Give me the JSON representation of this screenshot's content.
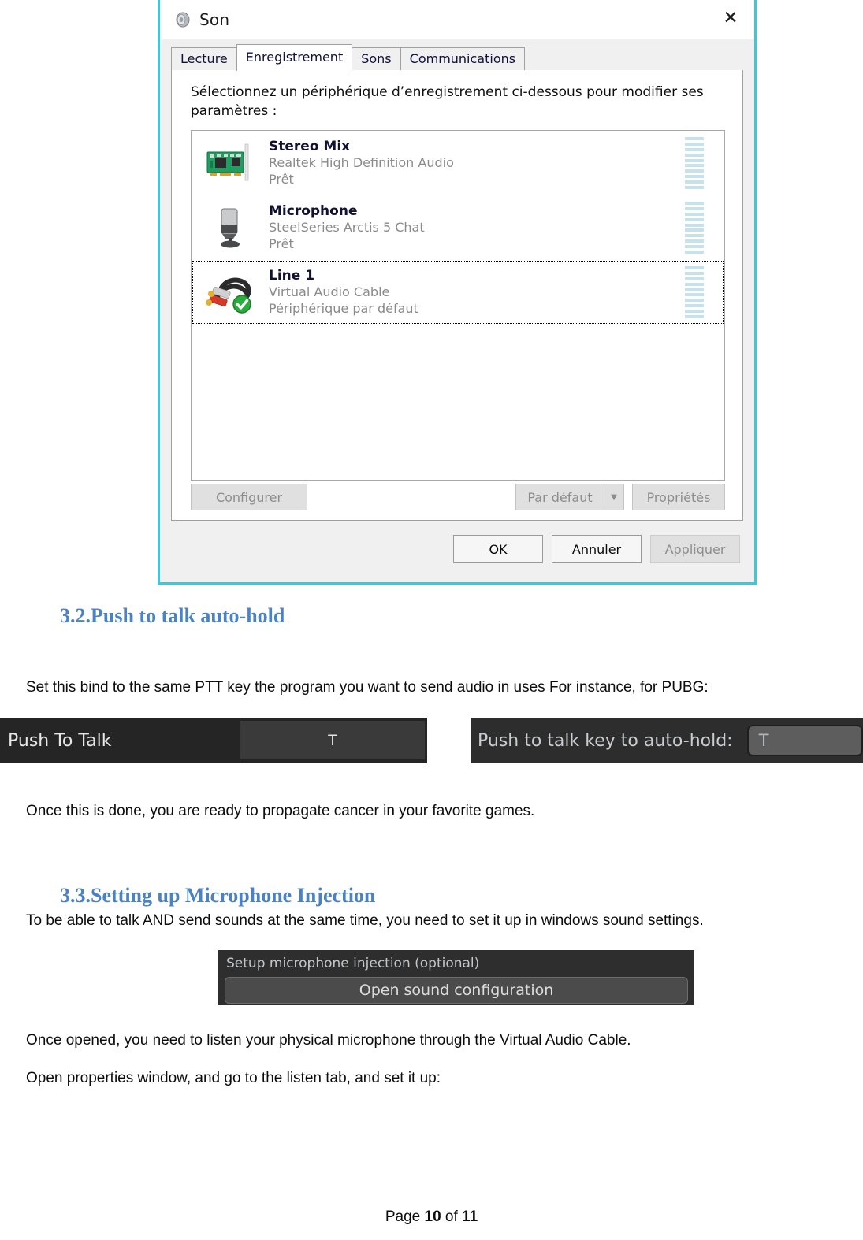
{
  "dialog": {
    "title": "Son",
    "title_icon": "speaker-icon",
    "close_label": "✕",
    "tabs": [
      {
        "label": "Lecture",
        "active": false
      },
      {
        "label": "Enregistrement",
        "active": true
      },
      {
        "label": "Sons",
        "active": false
      },
      {
        "label": "Communications",
        "active": false
      }
    ],
    "prompt": "Sélectionnez un périphérique d’enregistrement ci-dessous pour modifier ses paramètres :",
    "devices": [
      {
        "name": "Stereo Mix",
        "driver": "Realtek High Definition Audio",
        "status": "Prêt",
        "icon": "sound-card-icon",
        "selected": false,
        "default": false,
        "meter_segments": 10
      },
      {
        "name": "Microphone",
        "driver": "SteelSeries Arctis 5 Chat",
        "status": "Prêt",
        "icon": "microphone-icon",
        "selected": false,
        "default": false,
        "meter_segments": 10
      },
      {
        "name": "Line 1",
        "driver": "Virtual Audio Cable",
        "status": "Périphérique par défaut",
        "icon": "rca-cable-icon",
        "selected": true,
        "default": true,
        "meter_segments": 10
      }
    ],
    "panel_buttons": {
      "configure": "Configurer",
      "set_default": "Par défaut",
      "set_default_arrow": "▼",
      "properties": "Propriétés"
    },
    "footer_buttons": {
      "ok": "OK",
      "cancel": "Annuler",
      "apply": "Appliquer"
    }
  },
  "document": {
    "heading_32": "3.2.Push to talk auto-hold",
    "para_ptt": "Set this bind to the same PTT key the program you want to send audio in uses For instance, for PUBG:",
    "para_once_done": "Once this is done, you are ready to propagate cancer in your favorite games.",
    "heading_33": "3.3.Setting up Microphone Injection",
    "para_talk_and": "To be able to talk AND send sounds at the same time, you need to set it up in windows sound settings.",
    "para_once_opened": "Once opened, you need to listen your physical microphone through the Virtual Audio Cable.",
    "para_open_props": "Open properties window, and go to the listen tab, and set it up:",
    "footer": {
      "prefix": "Page ",
      "current": "10",
      "middle": " of ",
      "total": "11"
    }
  },
  "ptt_widget": {
    "label": "Push To Talk",
    "key": "T"
  },
  "autohold_widget": {
    "label": "Push to talk key to auto-hold:",
    "key": "T"
  },
  "injection_widget": {
    "title": "Setup microphone injection (optional)",
    "button": "Open sound configuration"
  },
  "colors": {
    "dialog_border": "#3ec6da",
    "heading_blue": "#4a82c4",
    "vu_segment": "#c6e2ec",
    "default_badge_green": "#2aad3e"
  }
}
